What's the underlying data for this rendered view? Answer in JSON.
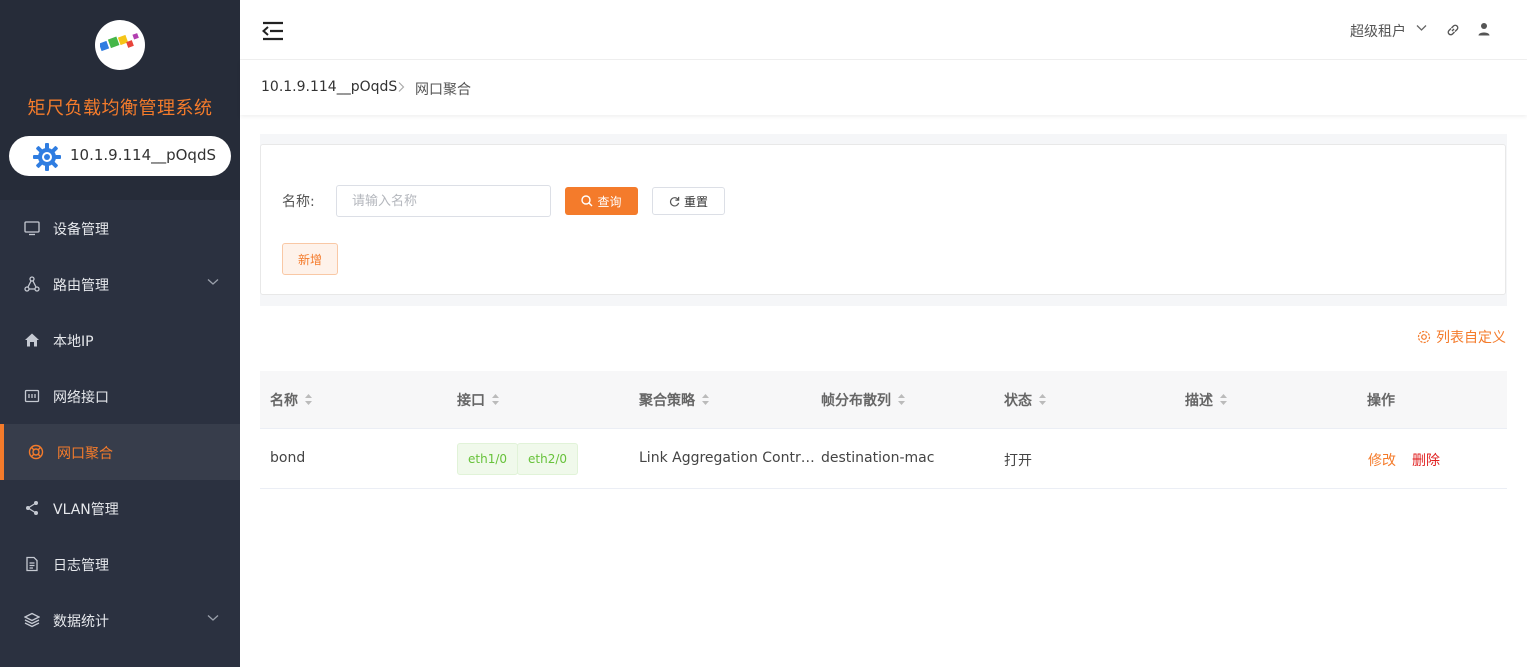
{
  "brand": {
    "title": "矩尺负载均衡管理系统",
    "device": "10.1.9.114__pOqdS",
    "accent_color": "#f47b2b"
  },
  "menu": {
    "items": [
      {
        "label": "设备管理",
        "icon": "monitor-icon"
      },
      {
        "label": "路由管理",
        "icon": "share-nodes-icon",
        "expandable": true
      },
      {
        "label": "本地IP",
        "icon": "home-icon"
      },
      {
        "label": "网络接口",
        "icon": "interface-icon"
      },
      {
        "label": "网口聚合",
        "icon": "lifebuoy-icon",
        "active": true
      },
      {
        "label": "VLAN管理",
        "icon": "share-icon"
      },
      {
        "label": "日志管理",
        "icon": "document-icon"
      },
      {
        "label": "数据统计",
        "icon": "layers-icon",
        "expandable": true
      }
    ]
  },
  "header": {
    "tenant": "超级租户"
  },
  "breadcrumb": {
    "device": "10.1.9.114__pOqdS",
    "current": "网口聚合"
  },
  "search": {
    "name_label": "名称:",
    "name_placeholder": "请输入名称",
    "query_label": "查询",
    "reset_label": "重置",
    "add_label": "新增"
  },
  "list_customize": "列表自定义",
  "table": {
    "columns": [
      "名称",
      "接口",
      "聚合策略",
      "帧分布散列",
      "状态",
      "描述",
      "操作"
    ],
    "rows": [
      {
        "name": "bond",
        "interfaces": [
          "eth1/0",
          "eth2/0"
        ],
        "policy": "Link Aggregation Contr…",
        "hash": "destination-mac",
        "status": "打开",
        "description": "",
        "actions": {
          "edit": "修改",
          "delete": "删除"
        }
      }
    ]
  }
}
